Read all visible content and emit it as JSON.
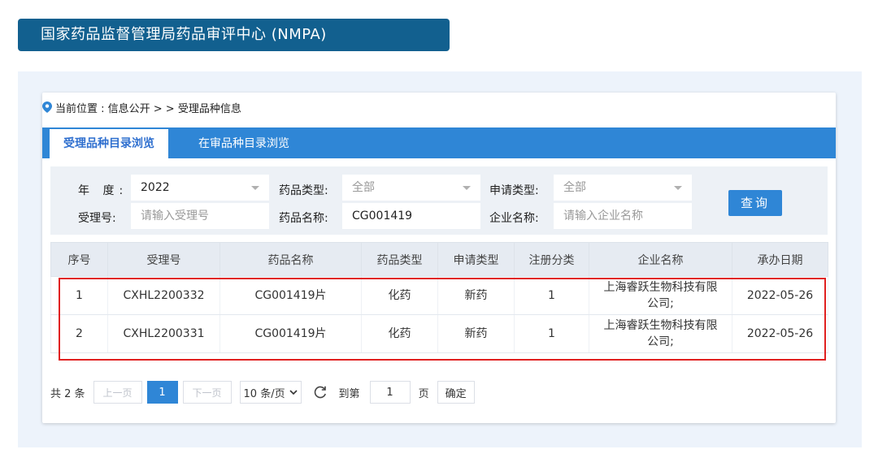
{
  "header": {
    "title": "国家药品监督管理局药品审评中心 (NMPA)"
  },
  "breadcrumb": {
    "text": "当前位置 : 信息公开 > > 受理品种信息"
  },
  "tabs": [
    {
      "label": "受理品种目录浏览"
    },
    {
      "label": "在审品种目录浏览"
    }
  ],
  "filters": {
    "year_label": "年  度:",
    "year_value": "2022",
    "drug_type_label": "药品类型:",
    "drug_type_value": "全部",
    "apply_type_label": "申请类型:",
    "apply_type_value": "全部",
    "accept_no_label": "受理号:",
    "accept_no_placeholder": "请输入受理号",
    "drug_name_label": "药品名称:",
    "drug_name_value": "CG001419",
    "company_label": "企业名称:",
    "company_placeholder": "请输入企业名称",
    "query_label": "查询"
  },
  "table": {
    "headers": [
      "序号",
      "受理号",
      "药品名称",
      "药品类型",
      "申请类型",
      "注册分类",
      "企业名称",
      "承办日期"
    ],
    "rows": [
      [
        "1",
        "CXHL2200332",
        "CG001419片",
        "化药",
        "新药",
        "1",
        "上海睿跃生物科技有限公司;",
        "2022-05-26"
      ],
      [
        "2",
        "CXHL2200331",
        "CG001419片",
        "化药",
        "新药",
        "1",
        "上海睿跃生物科技有限公司;",
        "2022-05-26"
      ]
    ]
  },
  "pagination": {
    "total": "共 2 条",
    "prev": "上一页",
    "current": "1",
    "next": "下一页",
    "page_size": "10 条/页",
    "goto_label": "到第",
    "goto_value": "1",
    "page_unit": "页",
    "confirm": "确定"
  },
  "colors": {
    "banner": "#12608f",
    "accent": "#2f86d6",
    "highlight": "#e02020"
  },
  "icons": {
    "breadcrumb": "location-pin-icon",
    "refresh": "refresh-icon",
    "dropdown": "chevron-down-icon"
  }
}
